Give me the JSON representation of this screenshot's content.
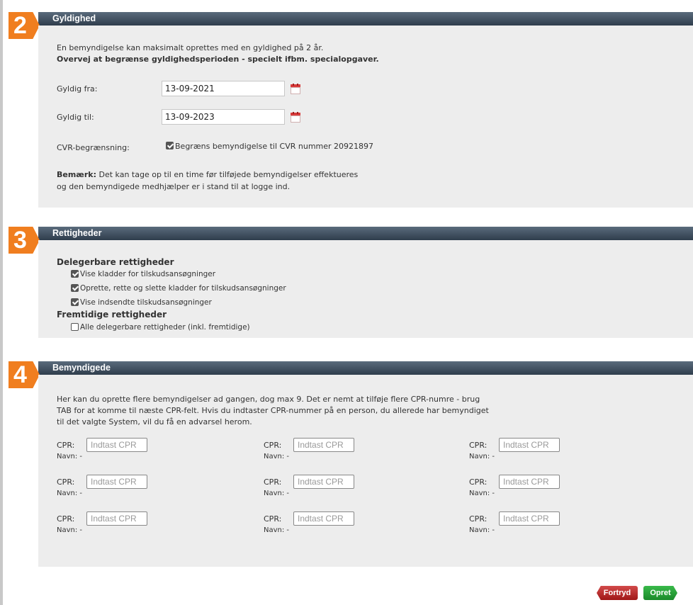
{
  "sections": {
    "validity": {
      "number": "2",
      "title": "Gyldighed",
      "intro_line1": "En bemyndigelse kan maksimalt oprettes med en gyldighed på 2 år.",
      "intro_line2": "Overvej at begrænse gyldighedsperioden - specielt ifbm. specialopgaver.",
      "from_label": "Gyldig fra:",
      "from_value": "13-09-2021",
      "to_label": "Gyldig til:",
      "to_value": "13-09-2023",
      "cvr_label": "CVR-begrænsning:",
      "cvr_checkbox_label": "Begræns bemyndigelse til CVR nummer 20921897",
      "cvr_checked": true,
      "note_bold": "Bemærk:",
      "note_line1": " Det kan tage op til en time før tilføjede bemyndigelser effektueres",
      "note_line2": "og den bemyndigede medhjælper er i stand til at logge ind."
    },
    "rights": {
      "number": "3",
      "title": "Rettigheder",
      "delegable_heading": "Delegerbare rettigheder",
      "delegable_items": [
        {
          "label": "Vise kladder for tilskudsansøgninger",
          "checked": true
        },
        {
          "label": "Oprette, rette og slette kladder for tilskudsansøgninger",
          "checked": true
        },
        {
          "label": "Vise indsendte tilskudsansøgninger",
          "checked": true
        }
      ],
      "future_heading": "Fremtidige rettigheder",
      "future_items": [
        {
          "label": "Alle delegerbare rettigheder (inkl. fremtidige)",
          "checked": false
        }
      ]
    },
    "authorized": {
      "number": "4",
      "title": "Bemyndigede",
      "intro_line1": "Her kan du oprette flere bemyndigelser ad gangen, dog max 9. Det er nemt at tilføje flere CPR-numre - brug",
      "intro_line2": "TAB for at komme til næste CPR-felt. Hvis du indtaster CPR-nummer på en person, du allerede har bemyndiget",
      "intro_line3": "til det valgte System, vil du få en advarsel herom.",
      "cpr_label": "CPR:",
      "cpr_placeholder": "Indtast CPR",
      "name_label": "Navn: -"
    }
  },
  "buttons": {
    "cancel": "Fortryd",
    "create": "Opret"
  },
  "colors": {
    "badge_orange": "#f07e1f",
    "header_dark": "#2f3d4c",
    "body_gray": "#ededed",
    "cancel_red": "#c03030",
    "create_green": "#2ea33d"
  }
}
